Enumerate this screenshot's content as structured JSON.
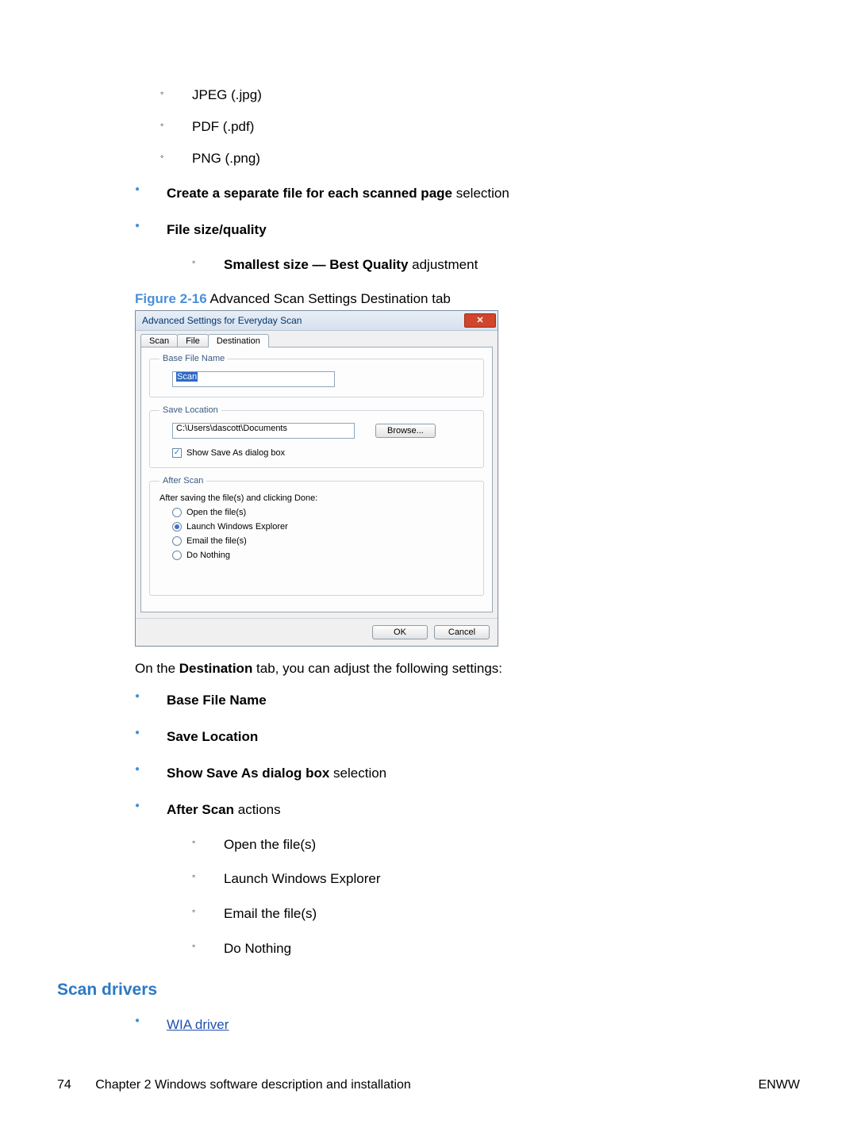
{
  "format_list": {
    "i0": "JPEG (.jpg)",
    "i1": "PDF (.pdf)",
    "i2": "PNG (.png)"
  },
  "bullets1": {
    "i0_bold": "Create a separate file for each scanned page",
    "i0_tail": " selection",
    "i1_bold": "File size/quality",
    "i1_sub_bold": "Smallest size — Best Quality",
    "i1_sub_tail": " adjustment"
  },
  "figure": {
    "label": "Figure 2-16",
    "caption": "  Advanced Scan Settings Destination tab"
  },
  "dialog": {
    "title": "Advanced Settings for Everyday Scan",
    "tabs": {
      "t0": "Scan",
      "t1": "File",
      "t2": "Destination"
    },
    "base_legend": "Base File Name",
    "base_value": "Scan",
    "save_legend": "Save Location",
    "save_value": "C:\\Users\\dascott\\Documents",
    "browse": "Browse...",
    "show_saveas": "Show Save As dialog box",
    "after_legend": "After Scan",
    "after_prompt": "After saving the file(s) and clicking Done:",
    "r0": "Open the file(s)",
    "r1": "Launch Windows Explorer",
    "r2": "Email the file(s)",
    "r3": "Do Nothing",
    "ok": "OK",
    "cancel": "Cancel"
  },
  "para": {
    "pre": "On the ",
    "bold": "Destination",
    "post": " tab, you can adjust the following settings:"
  },
  "bullets2": {
    "i0": "Base File Name",
    "i1": "Save Location",
    "i2_bold": "Show Save As dialog box",
    "i2_tail": " selection",
    "i3_bold": "After Scan",
    "i3_tail": " actions",
    "s0": "Open the file(s)",
    "s1": "Launch Windows Explorer",
    "s2": "Email the file(s)",
    "s3": "Do Nothing"
  },
  "heading": "Scan drivers",
  "link": "WIA driver",
  "footer": {
    "page": "74",
    "chapter": "Chapter 2   Windows software description and installation",
    "right": "ENWW"
  }
}
